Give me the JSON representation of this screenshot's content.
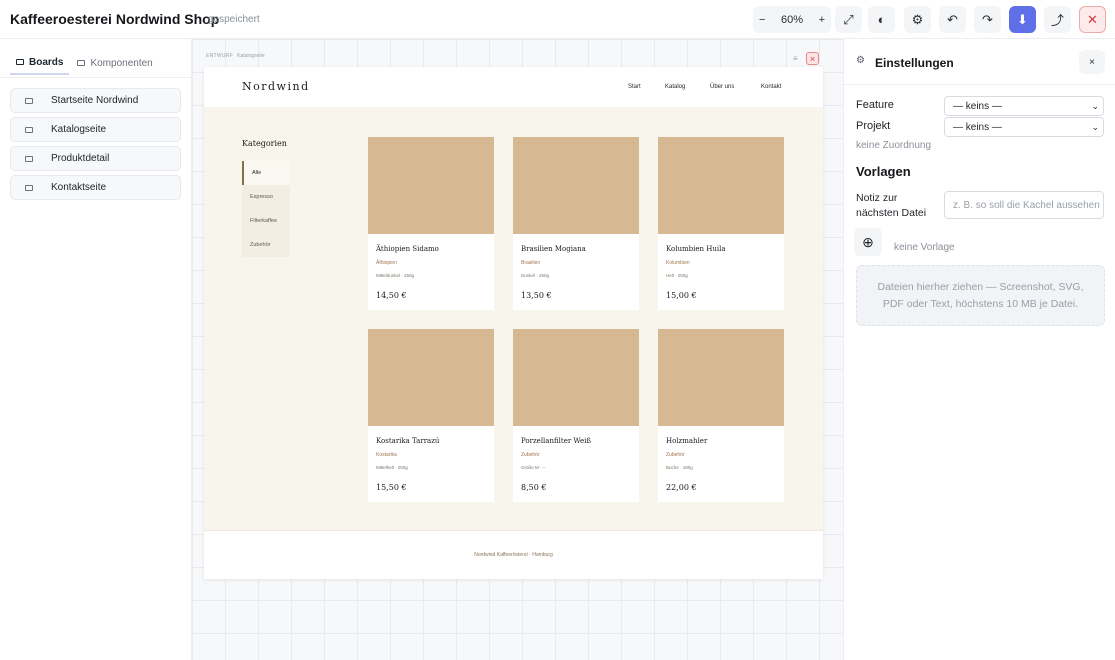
{
  "app": {
    "title": "Kaffeeroesterei Nordwind Shop",
    "status": "gespeichert"
  },
  "toolbar": {
    "zoom_out": "−",
    "zoom_level": "60%",
    "zoom_in": "+",
    "fit": "⤢",
    "theme": "◐",
    "settings": "⚙",
    "undo": "↶",
    "redo": "↷",
    "download": "⬇",
    "share": "⤴",
    "close": "✕"
  },
  "sidebar": {
    "tabs": [
      {
        "label": "Boards",
        "active": true
      },
      {
        "label": "Komponenten",
        "active": false
      }
    ],
    "items": [
      {
        "label": "Startseite Nordwind"
      },
      {
        "label": "Katalogseite"
      },
      {
        "label": "Produktdetail"
      },
      {
        "label": "Kontaktseite"
      }
    ]
  },
  "canvas": {
    "board_kind": "ENTWURF",
    "board_name": "Katalogseite",
    "board_menu": "≡",
    "board_close": "×",
    "site": {
      "logo": "Nordwind",
      "nav": [
        "Start",
        "Katalog",
        "Über uns",
        "Kontakt"
      ],
      "categories_title": "Kategorien",
      "categories": [
        {
          "label": "Alle",
          "active": true
        },
        {
          "label": "Espresso",
          "active": false
        },
        {
          "label": "Filterkaffee",
          "active": false
        },
        {
          "label": "Zubehör",
          "active": false
        }
      ],
      "products": [
        {
          "name": "Äthiopien Sidamo",
          "origin": "Äthiopien",
          "meta": "Mitteldunkel · 250g",
          "price": "14,50 €"
        },
        {
          "name": "Brasilien Mogiana",
          "origin": "Brasilien",
          "meta": "Dunkel · 250g",
          "price": "13,50 €"
        },
        {
          "name": "Kolumbien Huila",
          "origin": "Kolumbien",
          "meta": "Hell · 250g",
          "price": "15,00 €"
        },
        {
          "name": "Kostarika Tarrazú",
          "origin": "Kostarika",
          "meta": "Mittelhell · 250g",
          "price": "15,50 €"
        },
        {
          "name": "Porzellanfilter Weiß",
          "origin": "Zubehör",
          "meta": "Größe M · –",
          "price": "8,50 €"
        },
        {
          "name": "Holzmahler",
          "origin": "Zubehör",
          "meta": "Buche · 180g",
          "price": "22,00 €"
        }
      ],
      "footer": "Nordwind Kaffeerösterei · Hamburg",
      "colors": {
        "image_placeholder": "#d6b893",
        "background": "#f8f5ec",
        "accent": "#8b6d4a"
      }
    }
  },
  "settings_panel": {
    "title": "Einstellungen",
    "close": "×",
    "feature_label": "Feature",
    "feature_value": "— keins —",
    "project_label": "Projekt",
    "project_value": "— keins —",
    "assignment_hint": "keine Zuordnung",
    "templates_heading": "Vorlagen",
    "note_label": "Notiz zur nächsten Datei",
    "note_placeholder": "z. B. so soll die Kachel aussehen",
    "add_icon": "⊕",
    "no_template": "keine Vorlage",
    "dropzone_text": "Dateien hierher ziehen — Screenshot, SVG, PDF oder Text, höchstens 10 MB je Datei."
  },
  "colors": {
    "primary": "#5f6fe8",
    "danger": "#d43a3a"
  }
}
